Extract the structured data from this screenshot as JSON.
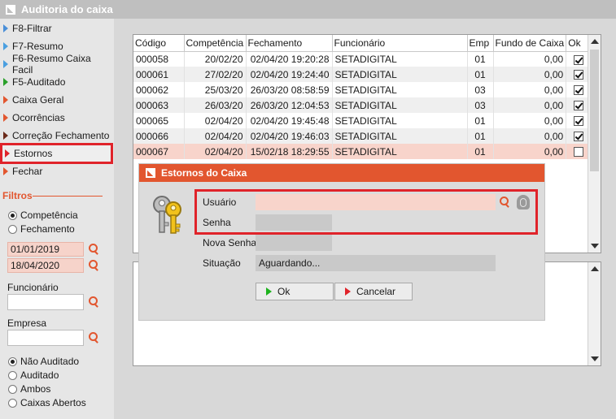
{
  "window": {
    "title": "Auditoria do caixa"
  },
  "menu": {
    "items": [
      {
        "label": "F8-Filtrar",
        "color": "#4a8fd8"
      },
      {
        "label": "F7-Resumo",
        "color": "#4a9fe0"
      },
      {
        "label": "F6-Resumo Caixa Facil",
        "color": "#4a9fe0"
      },
      {
        "label": "F5-Auditado",
        "color": "#2aa02a"
      },
      {
        "label": "Caixa Geral",
        "color": "#e2562f"
      },
      {
        "label": "Ocorrências",
        "color": "#e2562f"
      },
      {
        "label": "Correção Fechamento",
        "color": "#6a2a1a"
      },
      {
        "label": "Estornos",
        "color": "#e0232a"
      },
      {
        "label": "Fechar",
        "color": "#e2562f"
      }
    ]
  },
  "filters": {
    "title": "Filtros",
    "date_type": {
      "options": [
        "Competência",
        "Fechamento"
      ],
      "selected": "Competência"
    },
    "date_from": "01/01/2019",
    "date_to": "18/04/2020",
    "employee_label": "Funcionário",
    "employee_value": "",
    "company_label": "Empresa",
    "company_value": "",
    "status": {
      "options": [
        "Não Auditado",
        "Auditado",
        "Ambos",
        "Caixas Abertos"
      ],
      "selected": "Não Auditado"
    }
  },
  "grid": {
    "columns": [
      "Código",
      "Competência",
      "Fechamento",
      "Funcionário",
      "Emp",
      "Fundo de Caixa",
      "Ok"
    ],
    "rows": [
      {
        "codigo": "000058",
        "competencia": "20/02/20",
        "fechamento": "02/04/20 19:20:28",
        "funcionario": "SETADIGITAL",
        "emp": "01",
        "fundo": "0,00",
        "ok": true
      },
      {
        "codigo": "000061",
        "competencia": "27/02/20",
        "fechamento": "02/04/20 19:24:40",
        "funcionario": "SETADIGITAL",
        "emp": "01",
        "fundo": "0,00",
        "ok": true
      },
      {
        "codigo": "000062",
        "competencia": "25/03/20",
        "fechamento": "26/03/20 08:58:59",
        "funcionario": "SETADIGITAL",
        "emp": "03",
        "fundo": "0,00",
        "ok": true
      },
      {
        "codigo": "000063",
        "competencia": "26/03/20",
        "fechamento": "26/03/20 12:04:53",
        "funcionario": "SETADIGITAL",
        "emp": "03",
        "fundo": "0,00",
        "ok": true
      },
      {
        "codigo": "000065",
        "competencia": "02/04/20",
        "fechamento": "02/04/20 19:45:48",
        "funcionario": "SETADIGITAL",
        "emp": "01",
        "fundo": "0,00",
        "ok": true
      },
      {
        "codigo": "000066",
        "competencia": "02/04/20",
        "fechamento": "02/04/20 19:46:03",
        "funcionario": "SETADIGITAL",
        "emp": "01",
        "fundo": "0,00",
        "ok": true
      },
      {
        "codigo": "000067",
        "competencia": "02/04/20",
        "fechamento": "15/02/18 18:29:55",
        "funcionario": "SETADIGITAL",
        "emp": "01",
        "fundo": "0,00",
        "ok": false
      }
    ]
  },
  "dialog": {
    "title": "Estornos do Caixa",
    "user_label": "Usuário",
    "user_value": "",
    "password_label": "Senha",
    "password_value": "",
    "new_password_label": "Nova Senha",
    "new_password_value": "",
    "status_label": "Situação",
    "status_value": "Aguardando...",
    "ok_label": "Ok",
    "cancel_label": "Cancelar"
  },
  "colors": {
    "accent": "#e2562f",
    "highlight": "#e0232a",
    "selected_row": "#f8d4cb"
  },
  "icons": [
    "search-icon",
    "fingerprint-icon",
    "keys-icon",
    "checkbox-icon",
    "app-logo-icon"
  ]
}
